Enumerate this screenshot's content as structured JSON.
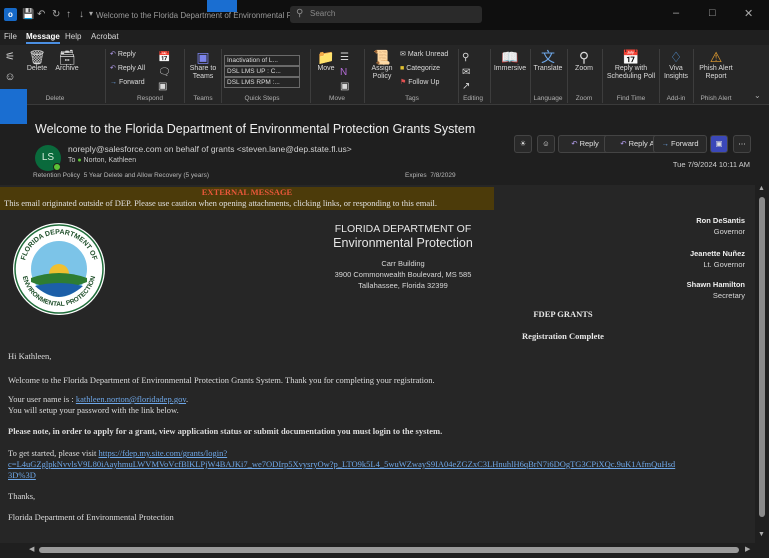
{
  "window": {
    "title": "Welcome to the Florida Department of Environmental Protection Grants System - Message (HT...",
    "search_placeholder": "Search"
  },
  "tabs": [
    "File",
    "Message",
    "Help",
    "Acrobat"
  ],
  "ribbon": {
    "delete": {
      "delete_label": "Delete",
      "archive_label": "Archive",
      "group": "Delete"
    },
    "respond": {
      "reply": "Reply",
      "reply_all": "Reply All",
      "forward": "Forward",
      "group": "Respond"
    },
    "teams": {
      "share": "Share to Teams",
      "group": "Teams"
    },
    "quick_steps": {
      "items": [
        "Inactivation of L...",
        "DSL LMS UP : C...",
        "DSL LMS RPM :..."
      ],
      "group": "Quick Steps"
    },
    "move": {
      "move_label": "Move",
      "group": "Move"
    },
    "tags": {
      "assign_policy": "Assign Policy",
      "mark_unread": "Mark Unread",
      "categorize": "Categorize",
      "follow_up": "Follow Up",
      "group": "Tags"
    },
    "editing": {
      "group": "Editing"
    },
    "immersive": {
      "label": "Immersive"
    },
    "language": {
      "translate": "Translate",
      "group": "Language"
    },
    "zoom": {
      "label": "Zoom",
      "group": "Zoom"
    },
    "find_time": {
      "reply_poll": "Reply with Scheduling Poll",
      "group": "Find Time"
    },
    "addin": {
      "viva": "Viva Insights",
      "group": "Add-in"
    },
    "phish": {
      "label": "Phish Alert Report",
      "group": "Phish Alert"
    }
  },
  "message": {
    "subject": "Welcome to the Florida Department of Environmental Protection Grants System",
    "avatar_initials": "LS",
    "from": "noreply@salesforce.com on behalf of grants <steven.lane@dep.state.fl.us>",
    "to_label": "To",
    "to": "Norton, Kathleen",
    "retention_label": "Retention Policy",
    "retention": "5 Year Delete and Allow Recovery (5 years)",
    "expires_label": "Expires",
    "expires": "7/8/2029",
    "date": "Tue 7/9/2024 10:11 AM",
    "actions": {
      "reply": "Reply",
      "reply_all": "Reply All",
      "forward": "Forward"
    }
  },
  "body": {
    "external_title": "EXTERNAL MESSAGE",
    "external_text": "This email originated outside of DEP. Please use caution when opening attachments, clicking links, or responding to this email.",
    "seal_text_top": "FLORIDA DEPARTMENT OF",
    "seal_text_bottom": "ENVIRONMENTAL PROTECTION",
    "dep_line1": "FLORIDA DEPARTMENT OF",
    "dep_line2": "Environmental Protection",
    "address": [
      "Carr Building",
      "3900 Commonwealth Boulevard, MS 585",
      "Tallahassee, Florida 32399"
    ],
    "officials": [
      {
        "name": "Ron DeSantis",
        "title": "Governor"
      },
      {
        "name": "Jeanette Nuñez",
        "title": "Lt. Governor"
      },
      {
        "name": "Shawn Hamilton",
        "title": "Secretary"
      }
    ],
    "grants_heading": "FDEP GRANTS",
    "registration": "Registration Complete",
    "greeting": "Hi Kathleen,",
    "welcome": "Welcome to the Florida Department of Environmental Protection Grants System. Thank you for completing your registration.",
    "username_prefix": "Your user name is : ",
    "username": "kathleen.norton@floridadep.gov",
    "username_suffix": ".",
    "password_line": "You will setup your password with the link below.",
    "note": "Please note, in order to apply for a grant, view application status or submit documentation you must login to the system.",
    "start_prefix": "To get started, please visit ",
    "login_url_1": "https://fdep.my.site.com/grants/login?",
    "login_url_2": "c=L4uGZglpkNvvlsV9L80iAayhmuLWVMVoVcfBlKLPjW4BAJKi7_we7ODIrp5XvysryOw?p_LTO9k5L4_5wuWZwayS9IA04eZGZxC3LHnuhlH6qBrN7i6DOgTG3CPiXQc.9uK1AfmQuHsd",
    "login_url_3": "3D%3D",
    "thanks": "Thanks,",
    "signature": "Florida Department of Environmental Protection"
  }
}
